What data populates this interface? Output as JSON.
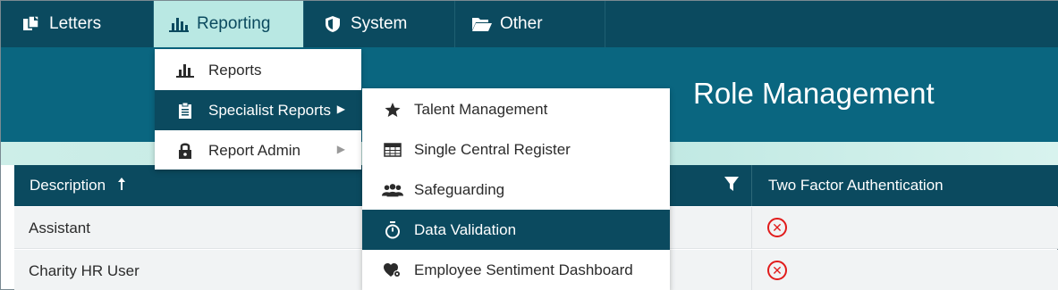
{
  "nav": {
    "items": [
      {
        "label": "Letters",
        "icon": "letters-icon"
      },
      {
        "label": "Reporting",
        "icon": "bar-chart-icon"
      },
      {
        "label": "System",
        "icon": "shield-icon"
      },
      {
        "label": "Other",
        "icon": "folder-icon"
      }
    ],
    "active": "Reporting"
  },
  "page": {
    "title": "Role Management"
  },
  "reporting_menu": {
    "items": [
      {
        "label": "Reports",
        "icon": "bar-chart-icon"
      },
      {
        "label": "Specialist Reports",
        "icon": "clipboard-icon",
        "submenu": true
      },
      {
        "label": "Report Admin",
        "icon": "lock-icon",
        "submenu": true
      }
    ]
  },
  "specialist_menu": {
    "items": [
      {
        "label": "Talent Management",
        "icon": "star-icon"
      },
      {
        "label": "Single Central Register",
        "icon": "table-icon"
      },
      {
        "label": "Safeguarding",
        "icon": "users-icon"
      },
      {
        "label": "Data Validation",
        "icon": "stopwatch-icon"
      },
      {
        "label": "Employee Sentiment Dashboard",
        "icon": "heart-gear-icon"
      }
    ]
  },
  "grid": {
    "columns": {
      "description": "Description",
      "two_factor": "Two Factor Authentication"
    },
    "rows": [
      {
        "description": "Assistant",
        "two_factor": false
      },
      {
        "description": "Charity HR User",
        "two_factor": false
      }
    ]
  },
  "colors": {
    "nav_bg": "#0b4a5f",
    "banner_bg": "#0a6680",
    "active_tab": "#b9e8e3",
    "error_red": "#e11b1b"
  }
}
